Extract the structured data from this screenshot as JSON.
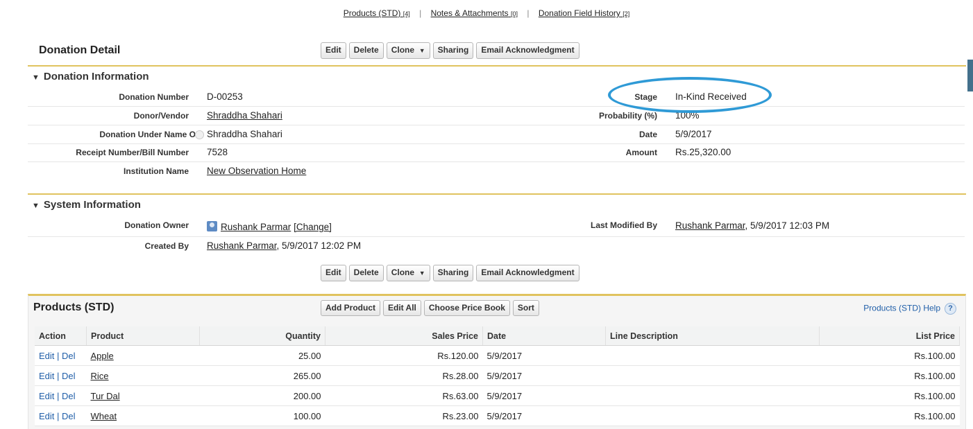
{
  "top_links": [
    {
      "label": "Products (STD)",
      "count": "[4]"
    },
    {
      "label": "Notes & Attachments",
      "count": "[0]"
    },
    {
      "label": "Donation Field History",
      "count": "[2]"
    }
  ],
  "title": "Donation Detail",
  "buttons": {
    "edit": "Edit",
    "delete": "Delete",
    "clone": "Clone",
    "clone_arrow": "▼",
    "sharing": "Sharing",
    "email_ack": "Email Acknowledgment"
  },
  "donation_info": {
    "header": "Donation Information",
    "left": [
      {
        "label": "Donation Number",
        "value": "D-00253"
      },
      {
        "label": "Donor/Vendor",
        "value": "Shraddha Shahari"
      },
      {
        "label": "Donation Under Name Of",
        "value": "Shraddha Shahari"
      },
      {
        "label": "Receipt Number/Bill Number",
        "value": "7528"
      },
      {
        "label": "Institution Name",
        "value": "New Observation Home"
      }
    ],
    "right": [
      {
        "label": "Stage",
        "value": "In-Kind Received"
      },
      {
        "label": "Probability (%)",
        "value": "100%"
      },
      {
        "label": "Date",
        "value": "5/9/2017"
      },
      {
        "label": "Amount",
        "value": "Rs.25,320.00"
      }
    ]
  },
  "system_info": {
    "header": "System Information",
    "owner_label": "Donation Owner",
    "owner_name": "Rushank Parmar",
    "owner_change": "[Change]",
    "created_label": "Created By",
    "created_name": "Rushank Parmar",
    "created_time": ", 5/9/2017 12:02 PM",
    "modified_label": "Last Modified By",
    "modified_name": "Rushank Parmar",
    "modified_time": ", 5/9/2017 12:03 PM"
  },
  "products": {
    "title": "Products (STD)",
    "buttons": {
      "add": "Add Product",
      "edit_all": "Edit All",
      "price_book": "Choose Price Book",
      "sort": "Sort"
    },
    "help_label": "Products (STD) Help",
    "help_icon": "?",
    "columns": {
      "action": "Action",
      "product": "Product",
      "quantity": "Quantity",
      "sales_price": "Sales Price",
      "date": "Date",
      "line_description": "Line Description",
      "list_price": "List Price"
    },
    "action_edit": "Edit",
    "action_sep": " | ",
    "action_del": "Del",
    "rows": [
      {
        "product": "Apple",
        "quantity": "25.00",
        "sales_price": "Rs.120.00",
        "date": "5/9/2017",
        "line_description": "",
        "list_price": "Rs.100.00"
      },
      {
        "product": "Rice",
        "quantity": "265.00",
        "sales_price": "Rs.28.00",
        "date": "5/9/2017",
        "line_description": "",
        "list_price": "Rs.100.00"
      },
      {
        "product": "Tur Dal",
        "quantity": "200.00",
        "sales_price": "Rs.63.00",
        "date": "5/9/2017",
        "line_description": "",
        "list_price": "Rs.100.00"
      },
      {
        "product": "Wheat",
        "quantity": "100.00",
        "sales_price": "Rs.23.00",
        "date": "5/9/2017",
        "line_description": "",
        "list_price": "Rs.100.00"
      }
    ]
  },
  "colors": {
    "section_bar": "#e0c35e",
    "highlight_ellipse": "#2f9ad6",
    "action_link": "#1f5ea8"
  }
}
